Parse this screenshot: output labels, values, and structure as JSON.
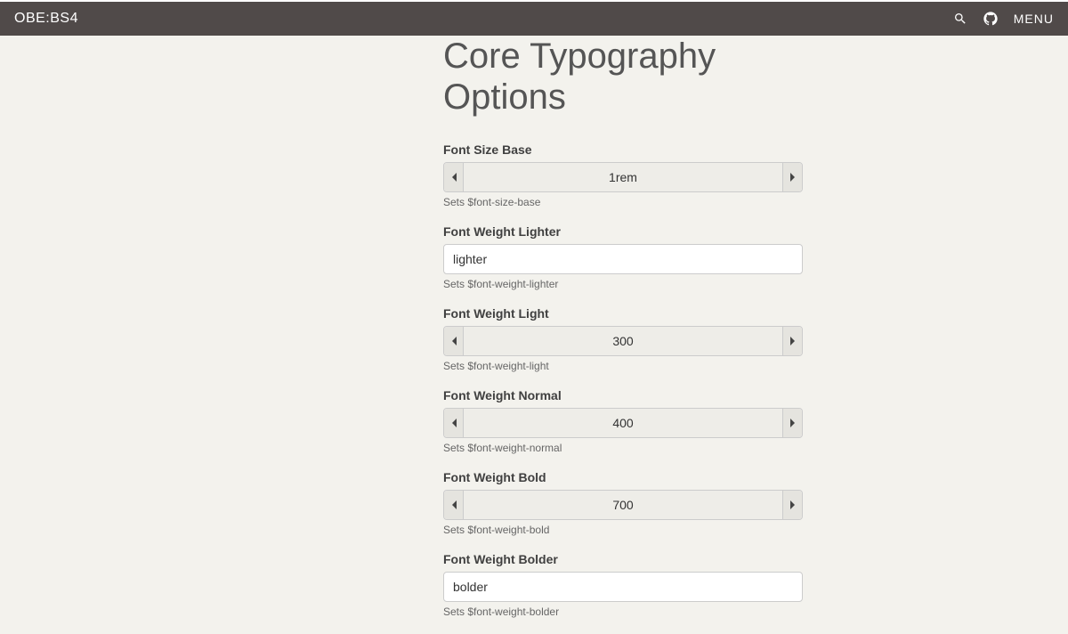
{
  "navbar": {
    "brand": "OBE:BS4",
    "menu": "MENU"
  },
  "page": {
    "title": "Core Typography Options"
  },
  "fields": {
    "fontSizeBase": {
      "label": "Font Size Base",
      "value": "1rem",
      "help": "Sets $font-size-base"
    },
    "fontWeightLighter": {
      "label": "Font Weight Lighter",
      "value": "lighter",
      "help": "Sets $font-weight-lighter"
    },
    "fontWeightLight": {
      "label": "Font Weight Light",
      "value": "300",
      "help": "Sets $font-weight-light"
    },
    "fontWeightNormal": {
      "label": "Font Weight Normal",
      "value": "400",
      "help": "Sets $font-weight-normal"
    },
    "fontWeightBold": {
      "label": "Font Weight Bold",
      "value": "700",
      "help": "Sets $font-weight-bold"
    },
    "fontWeightBolder": {
      "label": "Font Weight Bolder",
      "value": "bolder",
      "help": "Sets $font-weight-bolder"
    }
  }
}
